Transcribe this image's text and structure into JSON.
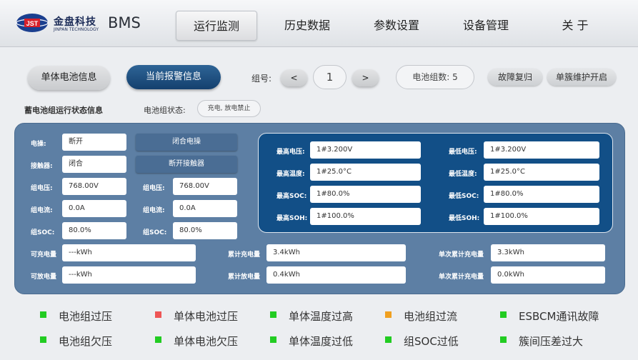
{
  "brand": {
    "name_cn": "金盘科技",
    "name_en": "JINPAN TECHNOLOGY",
    "logo_text": "JST"
  },
  "app_title": "BMS",
  "nav": [
    "运行监测",
    "历史数据",
    "参数设置",
    "设备管理",
    "关 于"
  ],
  "controls": {
    "single_cell_info": "单体电池信息",
    "current_alarm_info": "当前报警信息",
    "group_no_label": "组号:",
    "prev": "<",
    "group_no": "1",
    "next": ">",
    "group_count": "电池组数: 5",
    "fault_reset": "故障复归",
    "cluster_maintenance": "单簇维护开启"
  },
  "status": {
    "section_title": "蓄电池组运行状态信息",
    "group_state_label": "电池组状态:",
    "group_state_value": "充电, 放电禁止"
  },
  "left": {
    "breaker_label": "电操:",
    "breaker_value": "断开",
    "close_breaker_btn": "闭合电操",
    "contactor_label": "接触器:",
    "contactor_value": "闭合",
    "open_contactor_btn": "断开接触器",
    "voltage_label": "组电压:",
    "voltage_value": "768.00V",
    "voltage_label_2": "组电压:",
    "voltage_value_2": "768.00V",
    "current_label": "组电流:",
    "current_value": "0.0A",
    "current_label_2": "组电流:",
    "current_value_2": "0.0A",
    "soc_label": "组SOC:",
    "soc_value": "80.0%",
    "soc_label_2": "组SOC:",
    "soc_value_2": "80.0%"
  },
  "extremes": {
    "max_voltage_label": "最高电压:",
    "max_voltage": "1#3.200V",
    "min_voltage_label": "最低电压:",
    "min_voltage": "1#3.200V",
    "max_temp_label": "最高温度:",
    "max_temp": "1#25.0°C",
    "min_temp_label": "最低温度:",
    "min_temp": "1#25.0°C",
    "max_soc_label": "最高SOC:",
    "max_soc": "1#80.0%",
    "min_soc_label": "最低SOC:",
    "min_soc": "1#80.0%",
    "max_soh_label": "最高SOH:",
    "max_soh": "1#100.0%",
    "min_soh_label": "最低SOH:",
    "min_soh": "1#100.0%"
  },
  "energy": {
    "chargeable_label": "可充电量",
    "chargeable": "---kWh",
    "dischargeable_label": "可放电量",
    "dischargeable": "---kWh",
    "cum_charge_label": "累计充电量",
    "cum_charge": "3.4kWh",
    "cum_discharge_label": "累计放电量",
    "cum_discharge": "0.4kWh",
    "single_cum_charge_label": "单次累计充电量",
    "single_cum_charge": "3.3kWh",
    "single_cum_charge_label_2": "单次累计充电量",
    "single_cum_charge_2": "0.0kWh"
  },
  "alarms": [
    {
      "label": "电池组过压",
      "color": "#22cc22"
    },
    {
      "label": "单体电池过压",
      "color": "#ee5555"
    },
    {
      "label": "单体温度过高",
      "color": "#22cc22"
    },
    {
      "label": "电池组过流",
      "color": "#f0a020"
    },
    {
      "label": "ESBCM通讯故障",
      "color": "#22cc22"
    },
    {
      "label": "电池组欠压",
      "color": "#22cc22"
    },
    {
      "label": "单体电池欠压",
      "color": "#22cc22"
    },
    {
      "label": "单体温度过低",
      "color": "#22cc22"
    },
    {
      "label": "组SOC过低",
      "color": "#22cc22"
    },
    {
      "label": "簇间压差过大",
      "color": "#22cc22"
    }
  ]
}
